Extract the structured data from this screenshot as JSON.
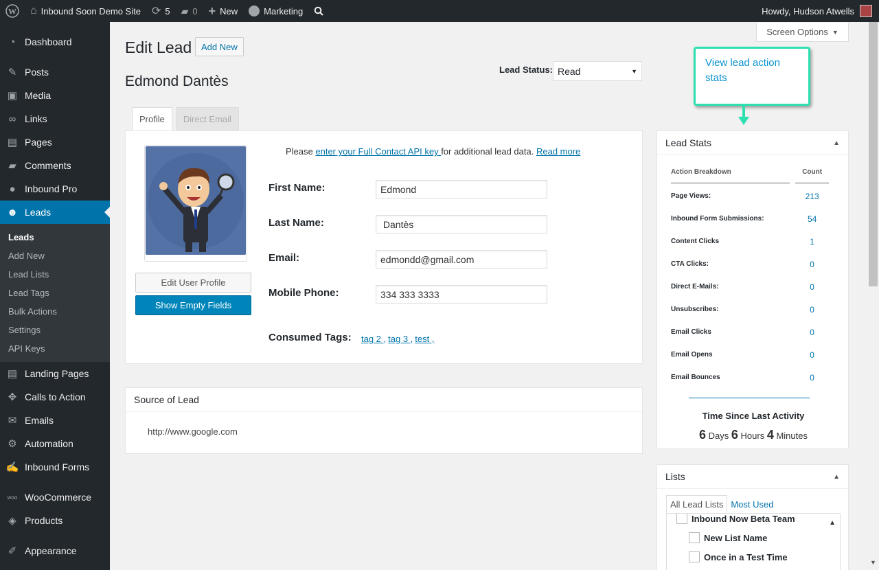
{
  "adminbar": {
    "site_name": "Inbound Soon Demo Site",
    "updates_count": "5",
    "comments_count": "0",
    "new_label": "New",
    "marketing_label": "Marketing",
    "howdy": "Howdy, Hudson Atwells"
  },
  "sidebar": {
    "items": [
      {
        "label": "Dashboard"
      },
      {
        "label": "Posts"
      },
      {
        "label": "Media"
      },
      {
        "label": "Links"
      },
      {
        "label": "Pages"
      },
      {
        "label": "Comments"
      },
      {
        "label": "Inbound Pro"
      },
      {
        "label": "Leads"
      },
      {
        "label": "Landing Pages"
      },
      {
        "label": "Calls to Action"
      },
      {
        "label": "Emails"
      },
      {
        "label": "Automation"
      },
      {
        "label": "Inbound Forms"
      },
      {
        "label": "WooCommerce"
      },
      {
        "label": "Products"
      },
      {
        "label": "Appearance"
      }
    ],
    "leads_submenu": [
      "Leads",
      "Add New",
      "Lead Lists",
      "Lead Tags",
      "Bulk Actions",
      "Settings",
      "API Keys"
    ]
  },
  "header": {
    "screen_options": "Screen Options",
    "title": "Edit Lead",
    "add_new": "Add New",
    "lead_name": "Edmond Dantès",
    "status_label": "Lead Status:",
    "status_value": "Read"
  },
  "tabs": [
    "Profile",
    "Direct Email"
  ],
  "profile": {
    "api_note_prefix": "Please ",
    "api_note_link": "enter your Full Contact API key ",
    "api_note_suffix": "for additional lead data. ",
    "read_more": "Read more",
    "edit_user_profile": "Edit User Profile",
    "show_empty_fields": "Show Empty Fields",
    "fields": [
      {
        "label": "First Name:",
        "value": "Edmond"
      },
      {
        "label": "Last Name:",
        "value": " Dantès"
      },
      {
        "label": "Email:",
        "value": "edmondd@gmail.com"
      },
      {
        "label": "Mobile Phone:",
        "value": "334 333 3333"
      }
    ],
    "consumed_tags_label": "Consumed Tags:",
    "tags": [
      "tag 2 ,",
      "tag 3 ,",
      "test ,"
    ]
  },
  "source": {
    "title": "Source of Lead",
    "url": "http://www.google.com"
  },
  "callout": {
    "text": "View lead action stats",
    "color": "#2de0b0"
  },
  "stats": {
    "title": "Lead Stats",
    "col_action": "Action Breakdown",
    "col_count": "Count",
    "rows": [
      {
        "label": "Page Views:",
        "count": "213"
      },
      {
        "label": "Inbound Form Submissions:",
        "count": "54"
      },
      {
        "label": "Content Clicks",
        "count": "1"
      },
      {
        "label": "CTA Clicks:",
        "count": "0"
      },
      {
        "label": "Direct E-Mails:",
        "count": "0"
      },
      {
        "label": "Unsubscribes:",
        "count": "0"
      },
      {
        "label": "Email Clicks",
        "count": "0"
      },
      {
        "label": "Email Opens",
        "count": "0"
      },
      {
        "label": "Email Bounces",
        "count": "0"
      }
    ],
    "since_title": "Time Since Last Activity",
    "days": "6",
    "days_label": "Days",
    "hours": "6",
    "hours_label": "Hours",
    "minutes": "4",
    "minutes_label": "Minutes"
  },
  "lists": {
    "title": "Lists",
    "tab_all": "All Lead Lists",
    "tab_most_used": "Most Used",
    "items": [
      "Inbound Now Beta Team",
      "New List Name",
      "Once in a Test Time"
    ]
  },
  "colors": {
    "accent": "#0073aa",
    "adminbar": "#23282d",
    "primary_button": "#0085ba"
  }
}
